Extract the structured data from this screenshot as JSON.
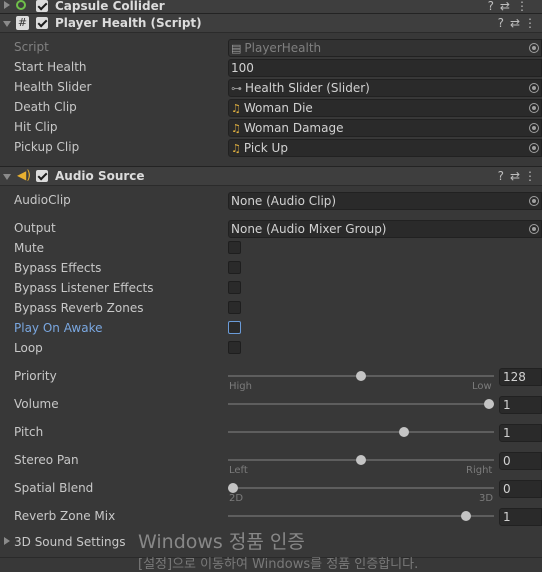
{
  "capsule_collider": {
    "title": "Capsule Collider"
  },
  "player_health": {
    "title": "Player Health (Script)",
    "fields": {
      "script_label": "Script",
      "script_value": "PlayerHealth",
      "start_health_label": "Start Health",
      "start_health_value": "100",
      "health_slider_label": "Health Slider",
      "health_slider_value": "Health Slider (Slider)",
      "death_clip_label": "Death Clip",
      "death_clip_value": "Woman Die",
      "hit_clip_label": "Hit Clip",
      "hit_clip_value": "Woman Damage",
      "pickup_clip_label": "Pickup Clip",
      "pickup_clip_value": "Pick Up"
    }
  },
  "audio_source": {
    "title": "Audio Source",
    "audioclip_label": "AudioClip",
    "audioclip_value": "None (Audio Clip)",
    "output_label": "Output",
    "output_value": "None (Audio Mixer Group)",
    "mute_label": "Mute",
    "mute_checked": false,
    "bypass_effects_label": "Bypass Effects",
    "bypass_effects_checked": false,
    "bypass_listener_label": "Bypass Listener Effects",
    "bypass_listener_checked": false,
    "bypass_reverb_label": "Bypass Reverb Zones",
    "bypass_reverb_checked": false,
    "play_on_awake_label": "Play On Awake",
    "play_on_awake_checked": false,
    "loop_label": "Loop",
    "loop_checked": false,
    "priority": {
      "label": "Priority",
      "value": "128",
      "fraction": 0.5,
      "min_label": "High",
      "max_label": "Low"
    },
    "volume": {
      "label": "Volume",
      "value": "1",
      "fraction": 1.0
    },
    "pitch": {
      "label": "Pitch",
      "value": "1",
      "fraction": 0.6667
    },
    "stereo_pan": {
      "label": "Stereo Pan",
      "value": "0",
      "fraction": 0.5,
      "min_label": "Left",
      "max_label": "Right"
    },
    "spatial_blend": {
      "label": "Spatial Blend",
      "value": "0",
      "fraction": 0.0,
      "min_label": "2D",
      "max_label": "3D"
    },
    "reverb_zone_mix": {
      "label": "Reverb Zone Mix",
      "value": "1",
      "fraction": 0.9091
    },
    "sound_settings_label": "3D Sound Settings"
  },
  "watermark": {
    "line1": "Windows 정품 인증",
    "line2": "[설정]으로 이동하여 Windows를 정품 인증합니다."
  },
  "icons": {
    "help": "help-icon",
    "presets": "presets-icon",
    "menu": "menu-icon",
    "audio_clip": "audio-clip-icon",
    "object_picker": "object-picker-icon"
  },
  "colors": {
    "background": "#383838",
    "header": "#3e3e3e",
    "field": "#2a2a2a",
    "audio_icon": "#e8b030",
    "script_icon": "#dcdcdc",
    "collider_icon": "#6fc04a",
    "highlight_blue": "#7aa7e0"
  }
}
